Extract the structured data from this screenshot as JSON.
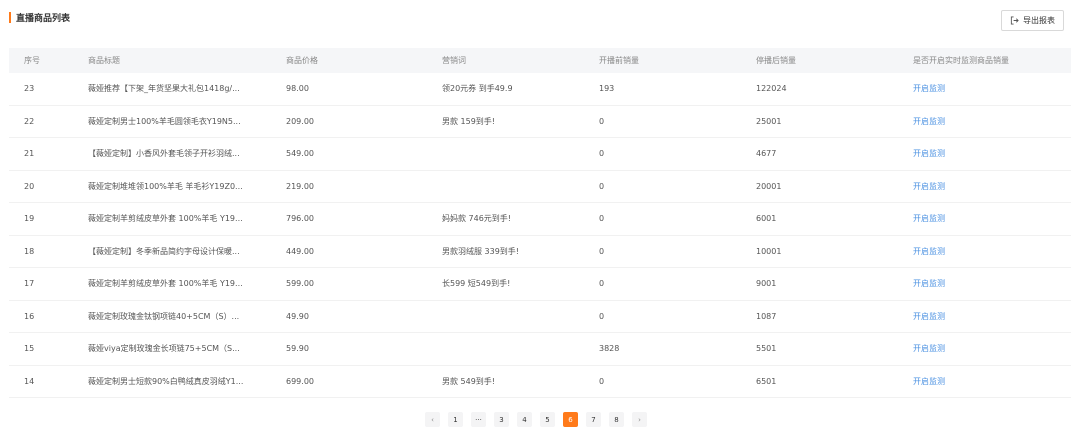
{
  "header": {
    "title": "直播商品列表",
    "export_label": "导出报表"
  },
  "table": {
    "columns": [
      "序号",
      "商品标题",
      "商品价格",
      "营销词",
      "开播前销量",
      "停播后销量",
      "是否开启实时监测商品销量"
    ],
    "rows": [
      {
        "no": "23",
        "title": "薇娅推荐【下架_年货坚果大礼包1418g/...",
        "price": "98.00",
        "promo": "领20元券 到手49.9",
        "before": "193",
        "after": "122024",
        "action": "开启监测"
      },
      {
        "no": "22",
        "title": "薇娅定制男士100%羊毛圆领毛衣Y19N5...",
        "price": "209.00",
        "promo": "男款 159到手!",
        "before": "0",
        "after": "25001",
        "action": "开启监测"
      },
      {
        "no": "21",
        "title": "【薇娅定制】小香风外套毛领子开衫羽绒...",
        "price": "549.00",
        "promo": "",
        "before": "0",
        "after": "4677",
        "action": "开启监测"
      },
      {
        "no": "20",
        "title": "薇娅定制堆堆领100%羊毛 羊毛衫Y19Z0...",
        "price": "219.00",
        "promo": "",
        "before": "0",
        "after": "20001",
        "action": "开启监测"
      },
      {
        "no": "19",
        "title": "薇娅定制羊剪绒皮草外套 100%羊毛 Y19...",
        "price": "796.00",
        "promo": "妈妈款 746元到手!",
        "before": "0",
        "after": "6001",
        "action": "开启监测"
      },
      {
        "no": "18",
        "title": "【薇娅定制】冬季新品简约字母设计保暖...",
        "price": "449.00",
        "promo": "男款羽绒服 339到手!",
        "before": "0",
        "after": "10001",
        "action": "开启监测"
      },
      {
        "no": "17",
        "title": "薇娅定制羊剪绒皮草外套 100%羊毛 Y19...",
        "price": "599.00",
        "promo": "长599 短549到手!",
        "before": "0",
        "after": "9001",
        "action": "开启监测"
      },
      {
        "no": "16",
        "title": "薇娅定制玫瑰金钛钢项链40+5CM（S）...",
        "price": "49.90",
        "promo": "",
        "before": "0",
        "after": "1087",
        "action": "开启监测"
      },
      {
        "no": "15",
        "title": "薇娅viya定制玫瑰金长项链75+5CM（S...",
        "price": "59.90",
        "promo": "",
        "before": "3828",
        "after": "5501",
        "action": "开启监测"
      },
      {
        "no": "14",
        "title": "薇娅定制男士短款90%白鸭绒真皮羽绒Y1...",
        "price": "699.00",
        "promo": "男款 549到手!",
        "before": "0",
        "after": "6501",
        "action": "开启监测"
      }
    ]
  },
  "pagination": {
    "prev": "‹",
    "next": "›",
    "pages": [
      "1",
      "···",
      "3",
      "4",
      "5",
      "6",
      "7",
      "8"
    ],
    "current": "6"
  }
}
